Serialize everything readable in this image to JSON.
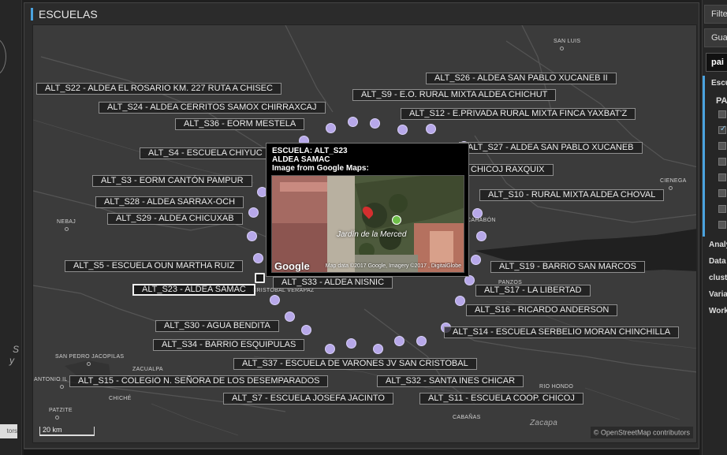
{
  "panel": {
    "title": "ESCUELAS"
  },
  "left_strip": {
    "text": "y",
    "text2": "S",
    "credit": "tors"
  },
  "sidebar": {
    "filter_button": "Filte",
    "save_button": "Gua",
    "search_value": "pai",
    "section_title": "Escu",
    "section_sub": "PAI",
    "checkbox_states": [
      false,
      true,
      false,
      false,
      false,
      false,
      false,
      false
    ],
    "menu": [
      "Analy",
      "Data",
      "clust",
      "Varia",
      "Work"
    ]
  },
  "map": {
    "towns": [
      {
        "name": "SAN LUIS"
      },
      {
        "name": "CIENEGA"
      },
      {
        "name": "NEBAJ"
      },
      {
        "name": "CAHABÓN"
      },
      {
        "name": "PANZOS"
      },
      {
        "name": "SAN PEDRO JACOPILAS"
      },
      {
        "name": "ZACUALPA"
      },
      {
        "name": "ANTONIO IL"
      },
      {
        "name": "CHICHÉ"
      },
      {
        "name": "PATZITE"
      },
      {
        "name": "RIO HONDO"
      },
      {
        "name": "CABAÑAS"
      },
      {
        "name": "Zacapa"
      },
      {
        "name": "CRISTOBAL VERAPAZ"
      }
    ],
    "schools": [
      {
        "label": "ALT_S22 - ALDEA EL ROSARIO KM. 227 RUTA A CHISEC"
      },
      {
        "label": "ALT_S26 - ALDEA SAN PABLO XUCANEB II"
      },
      {
        "label": "ALT_S9 - E.O. RURAL MIXTA ALDEA CHICHUT"
      },
      {
        "label": "ALT_S24 - ALDEA CERRITOS SAMOX CHIRRAXCAJ"
      },
      {
        "label": "ALT_S12 - E.PRIVADA RURAL MIXTA FINCA YAXBAT'Z"
      },
      {
        "label": "ALT_S36 - EORM MESTELA"
      },
      {
        "label": "ALT_S27 - ALDEA SAN PABLO XUCANEB"
      },
      {
        "label": "ALT_S4 - ESCUELA CHIYUC"
      },
      {
        "label": "CHICOJ RAXQUIX"
      },
      {
        "label": "ALT_S3 - EORM CANTÓN PAMPUR"
      },
      {
        "label": "ALT_S10 - RURAL MIXTA ALDEA CHOVAL"
      },
      {
        "label": "ALT_S28 - ALDEA SARRAX-OCH"
      },
      {
        "label": "ALT_S29 - ALDEA CHICUXAB"
      },
      {
        "label": "ALT_S5 - ESCUELA OUN MARTHA RUIZ"
      },
      {
        "label": "ALT_S19 - BARRIO SAN MARCOS"
      },
      {
        "label": "ALT_S33 - ALDEA NISNIC"
      },
      {
        "label": "ALT_S23 - ALDEA SAMAC"
      },
      {
        "label": "ALT_S17 - LA LIBERTAD"
      },
      {
        "label": "ALT_S16 - RICARDO ANDERSON"
      },
      {
        "label": "ALT_S30 - AGUA BENDITA"
      },
      {
        "label": "ALT_S14 - ESCUELA SERBELIO MORAN CHINCHILLA"
      },
      {
        "label": "ALT_S34 - BARRIO ESQUIPULAS"
      },
      {
        "label": "ALT_S37 - ESCUELA DE VARONES JV SAN CRISTOBAL"
      },
      {
        "label": "ALT_S15 - COLEGIO N. SEÑORA DE LOS DESEMPARADOS"
      },
      {
        "label": "ALT_S32 - SANTA INES CHICAR"
      },
      {
        "label": "ALT_S7 - ESCUELA JOSEFA JACINTO"
      },
      {
        "label": "ALT_S11 - ESCUELA COOP. CHICOJ"
      }
    ],
    "popup": {
      "line1": "ESCUELA: ALT_S23",
      "line2": "ALDEA SAMAC",
      "line3": "Image from Google Maps:",
      "place": "Jardín de la Merced",
      "google": "Google",
      "imagery": "Map data ©2017 Google, Imagery ©2017 , DigitalGlobe"
    },
    "scale": "20 km",
    "attribution": "© OpenStreetMap contributors"
  }
}
